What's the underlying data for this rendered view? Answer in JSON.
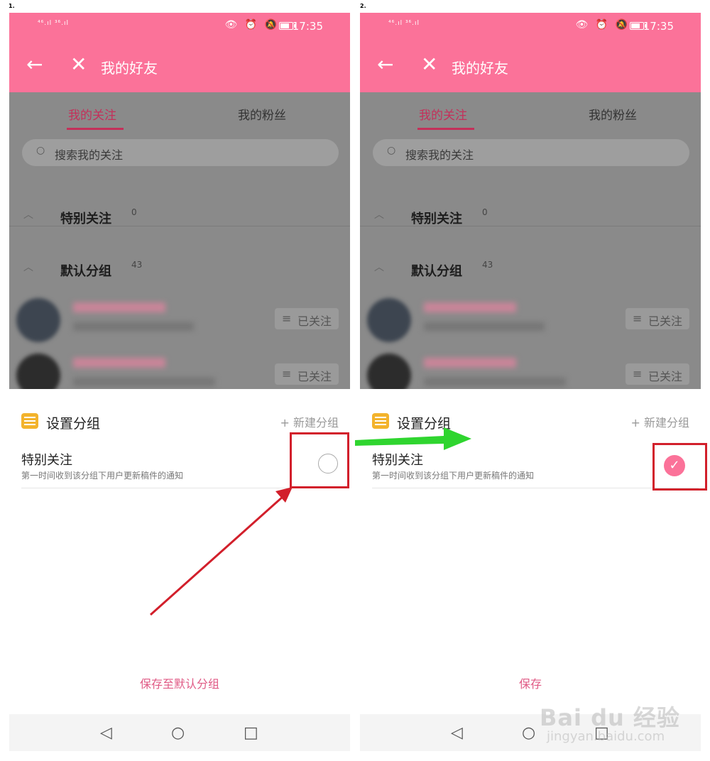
{
  "steps": [
    "1.",
    "2."
  ],
  "status_bar": {
    "signal": "⁴⁶.ıl ³⁶.ıl",
    "icons": "👁 ⏰ 🔕",
    "time": "17:35"
  },
  "app_bar": {
    "back_icon": "←",
    "close_icon": "✕",
    "title": "我的好友"
  },
  "tabs": [
    {
      "label": "我的关注",
      "active": true
    },
    {
      "label": "我的粉丝",
      "active": false
    }
  ],
  "search": {
    "icon": "search-icon",
    "placeholder": "搜索我的关注"
  },
  "groups": [
    {
      "name": "特别关注",
      "count": "0"
    },
    {
      "name": "默认分组",
      "count": "43"
    }
  ],
  "friend_rows": [
    {
      "follow_label": "已关注"
    },
    {
      "follow_label": "已关注"
    }
  ],
  "sheet": {
    "title": "设置分组",
    "new_group": "+ 新建分组",
    "option_title": "特别关注",
    "option_desc": "第一时间收到该分组下用户更新稿件的通知"
  },
  "save_labels": [
    "保存至默认分组",
    "保存"
  ],
  "option_checked": [
    false,
    true
  ],
  "watermark": {
    "main": "Bai du 经验",
    "sub": "jingyan.baidu.com"
  },
  "colors": {
    "brand_pink": "#fb7299",
    "highlight_red": "#d21f2b",
    "arrow_green": "#2fd52f"
  }
}
